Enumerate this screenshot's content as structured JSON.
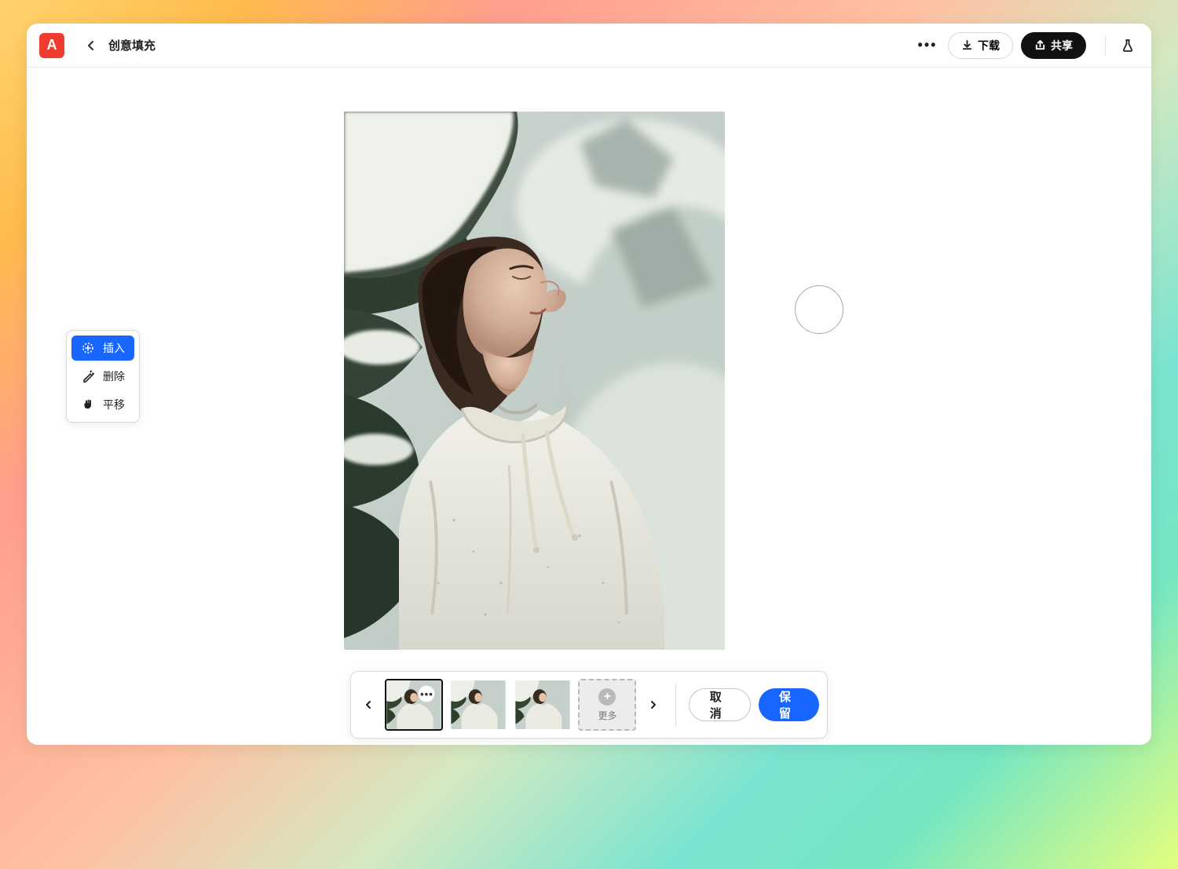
{
  "header": {
    "title": "创意填充",
    "more_dots": "•••",
    "download_label": "下载",
    "share_label": "共享"
  },
  "toolbox": {
    "insert": "插入",
    "delete": "删除",
    "pan": "平移"
  },
  "thumb_bar": {
    "more_label": "更多",
    "cancel_label": "取消",
    "keep_label": "保留"
  }
}
